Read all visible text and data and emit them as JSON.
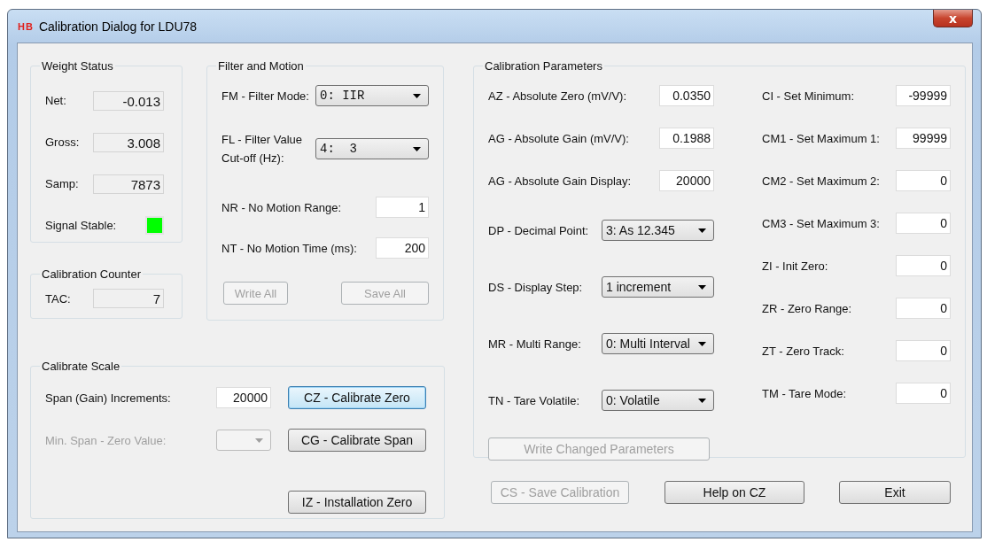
{
  "window": {
    "logo": "HB",
    "title": "Calibration Dialog for LDU78",
    "close": "x"
  },
  "weight_status": {
    "title": "Weight Status",
    "fields": [
      {
        "label": "Net:",
        "value": "-0.013"
      },
      {
        "label": "Gross:",
        "value": "3.008"
      },
      {
        "label": "Samp:",
        "value": "7873"
      }
    ],
    "signal": {
      "label": "Signal Stable:",
      "stable": true
    }
  },
  "calibration_counter": {
    "title": "Calibration Counter",
    "label": "TAC:",
    "value": "7"
  },
  "filter_motion": {
    "title": "Filter and Motion",
    "rows": [
      {
        "kind": "select",
        "label": "FM - Filter Mode:",
        "value": "0: IIR"
      },
      {
        "kind": "select",
        "label": "FL - Filter Value Cut-off (Hz):",
        "value": "4:  3"
      },
      {
        "kind": "input",
        "label": "NR - No Motion Range:",
        "value": "1"
      },
      {
        "kind": "input",
        "label": "NT - No Motion Time (ms):",
        "value": "200"
      }
    ],
    "buttons": [
      {
        "label": "Write All",
        "disabled": true
      },
      {
        "label": "Save All",
        "disabled": true
      }
    ]
  },
  "calibrate_scale": {
    "title": "Calibrate Scale",
    "span": {
      "label": "Span (Gain) Increments:",
      "value": "20000"
    },
    "min_span": {
      "label": "Min. Span - Zero Value:",
      "disabled": true
    },
    "buttons": [
      {
        "label": "CZ - Calibrate Zero",
        "focused": true
      },
      {
        "label": "CG - Calibrate Span",
        "focused": false
      },
      {
        "label": "IZ - Installation Zero",
        "focused": false
      }
    ]
  },
  "calibration_parameters": {
    "title": "Calibration Parameters",
    "left": [
      {
        "kind": "input",
        "label": "AZ - Absolute Zero (mV/V):",
        "value": "0.0350"
      },
      {
        "kind": "input",
        "label": "AG - Absolute Gain (mV/V):",
        "value": "0.1988"
      },
      {
        "kind": "input",
        "label": "AG - Absolute Gain Display:",
        "value": "20000"
      },
      {
        "kind": "select",
        "label": "DP - Decimal Point:",
        "value": "3: As 12.345"
      },
      {
        "kind": "select",
        "label": "DS - Display Step:",
        "value": "1 increment"
      },
      {
        "kind": "select",
        "label": "MR - Multi Range:",
        "value": "0: Multi Interval"
      },
      {
        "kind": "select",
        "label": "TN - Tare Volatile:",
        "value": "0: Volatile"
      }
    ],
    "right": [
      {
        "kind": "input",
        "label": "CI - Set Minimum:",
        "value": "-99999"
      },
      {
        "kind": "input",
        "label": "CM1 - Set Maximum 1:",
        "value": "99999"
      },
      {
        "kind": "input",
        "label": "CM2 - Set Maximum 2:",
        "value": "0"
      },
      {
        "kind": "input",
        "label": "CM3 - Set Maximum 3:",
        "value": "0"
      },
      {
        "kind": "input",
        "label": "ZI - Init Zero:",
        "value": "0"
      },
      {
        "kind": "input",
        "label": "ZR - Zero Range:",
        "value": "0"
      },
      {
        "kind": "input",
        "label": "ZT - Zero Track:",
        "value": "0"
      },
      {
        "kind": "input",
        "label": "TM - Tare Mode:",
        "value": "0"
      }
    ],
    "write_button": {
      "label": "Write Changed Parameters",
      "disabled": true
    }
  },
  "footer_buttons": [
    {
      "label": "CS - Save Calibration",
      "disabled": true
    },
    {
      "label": "Help on CZ",
      "disabled": false
    },
    {
      "label": "Exit",
      "disabled": false
    }
  ]
}
